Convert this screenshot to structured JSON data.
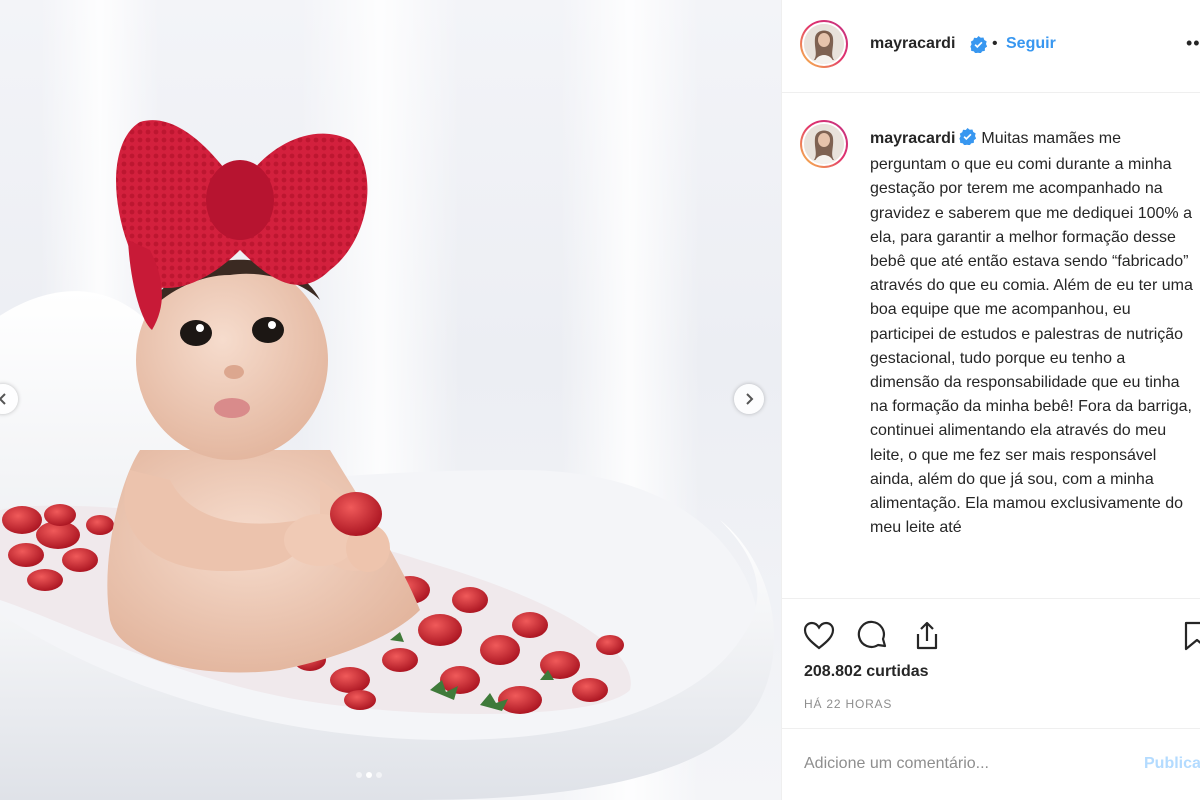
{
  "post": {
    "username": "mayracardi",
    "verified": true,
    "bullet": "•",
    "follow_label": "Seguir",
    "more_label": "••",
    "caption": "Muitas mamães me perguntam o que eu comi durante a minha gestação por terem me acompanhado na gravidez e saberem que me dediquei 100% a ela, para garantir a melhor formação desse bebê que até então estava sendo “fabricado” através do que eu comia. Além de eu ter uma boa equipe que me acompanhou, eu participei de estudos e palestras de nutrição gestacional, tudo porque eu tenho a dimensão da responsabilidade que eu tinha na formação da minha bebê! Fora da barriga, continuei alimentando ela através do meu leite, o que me fez ser mais responsável ainda, além do que já sou, com a minha alimentação. Ela mamou exclusivamente do meu leite até",
    "likes": "208.802 curtidas",
    "time": "HÁ 22 HORAS",
    "carousel": {
      "count": 3,
      "active": 2
    }
  },
  "icons": {
    "like": "heart-icon",
    "comment": "comment-bubble-icon",
    "share": "share-icon",
    "save": "bookmark-icon",
    "verified": "verified-badge-icon",
    "prev": "chevron-left-icon",
    "next": "chevron-right-icon"
  },
  "comment": {
    "placeholder": "Adicione um comentário...",
    "publish_label": "Publicar"
  },
  "colors": {
    "link_blue": "#3897f0",
    "publish_disabled": "#b3dbff",
    "bow_red": "#d3203d",
    "border": "#efefef"
  }
}
